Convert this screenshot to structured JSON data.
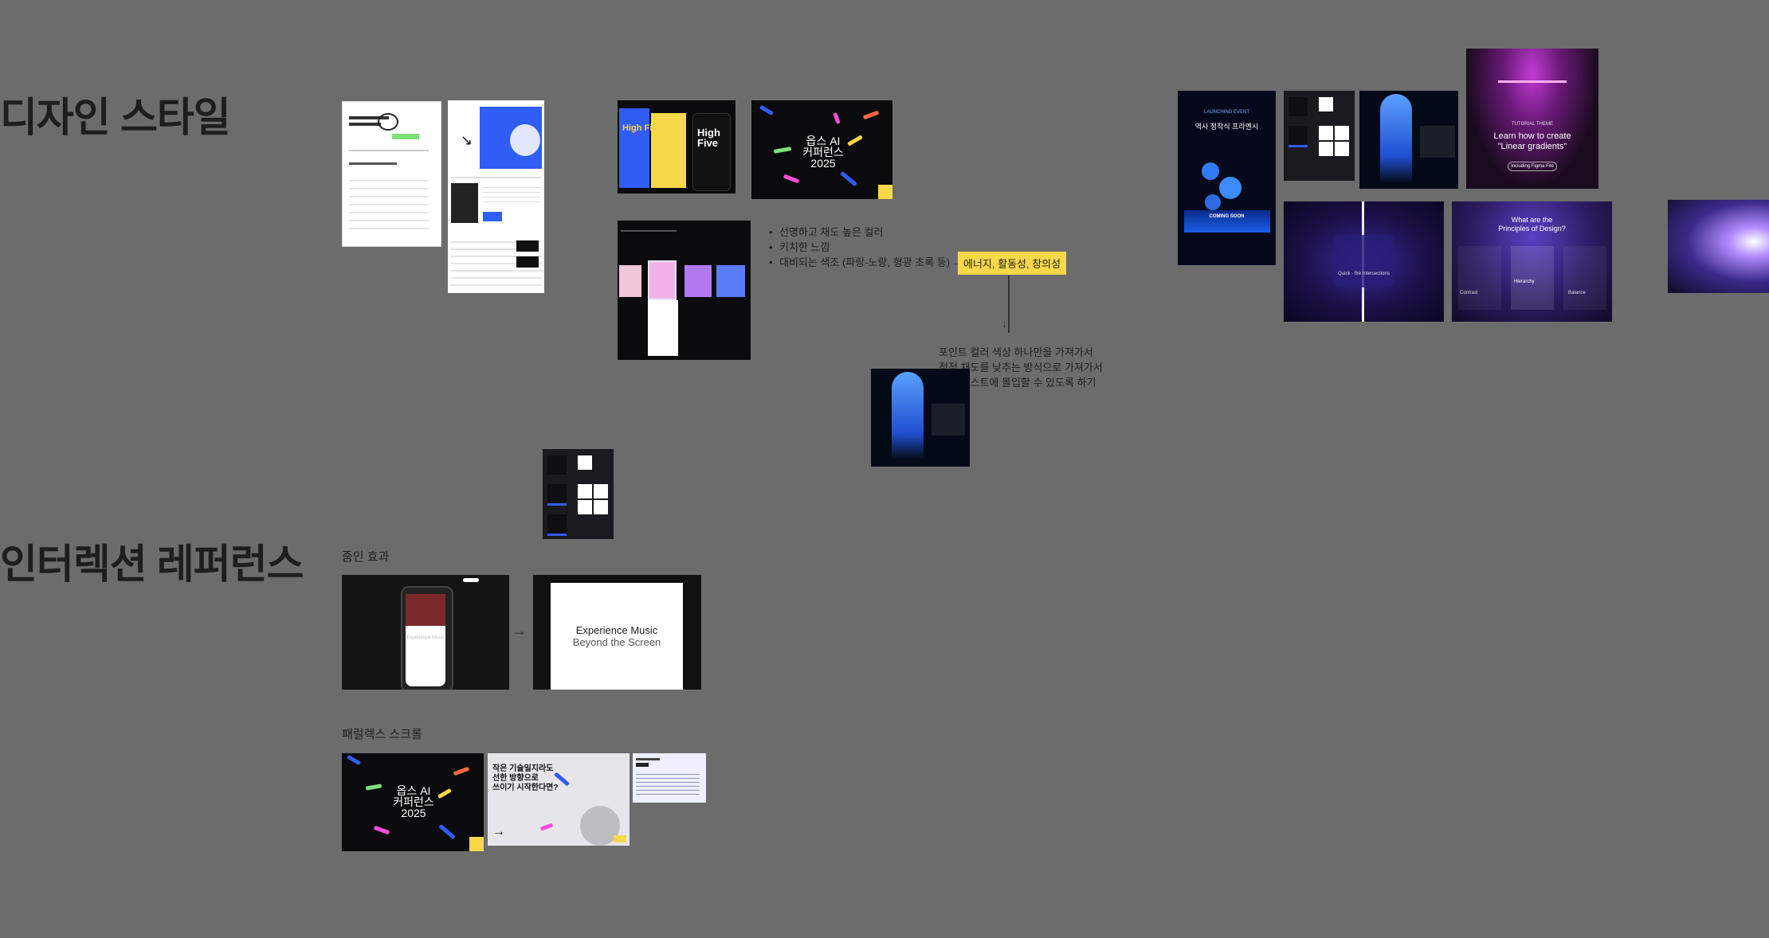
{
  "sections": {
    "design_style": {
      "title": "디자인 스타일"
    },
    "interaction_ref": {
      "title": "인터렉션 레퍼런스"
    }
  },
  "labels": {
    "zoom_in": "줌인 효과",
    "parallax": "패럴렉스 스크롤"
  },
  "notes": {
    "bullets": [
      "선명하고 채도 높은 컬러",
      "키치한 느낌",
      "대비되는 색조 (파랑-노랑, 형광 초록 등) →"
    ],
    "chip": "에너지, 활동성, 창의성",
    "arrow": "↓",
    "paragraph": [
      "포인트 컬러 색상 하나만을 가져가서",
      "점점 채도를 낮추는 방식으로 가져가서",
      "진단 테스트에 몰입할 수 있도록 하기"
    ]
  },
  "thumbs": {
    "high_five": "High Five",
    "ai_conf_line1": "옵스 AI",
    "ai_conf_line2": "커퍼런스",
    "ai_conf_year": "2025",
    "launching": "LAUNCHING EVENT",
    "korean_promo": "역사 정착식 프라멘시",
    "coming_soon": "COMING SOON",
    "tutorial": "TUTORIAL THEME",
    "linear_title1": "Learn how to create",
    "linear_title2": "\"Linear gradients\"",
    "linear_button": "Including Figma File",
    "quick_intersections": "Quick - fire Intersections",
    "principles1": "What are the",
    "principles2": "Principles of Design?",
    "hierarchy": "Hierarchy",
    "contrast": "Contrast",
    "balance": "Balance",
    "experience1": "Experience Music",
    "experience2": "Beyond the Screen",
    "experience_faint": "Experience Music",
    "small_tech1": "작은 기술일지라도",
    "small_tech2": "선한 방향으로",
    "small_tech3": "쓰이기 시작한다면?",
    "arrow_right": "→",
    "zoom_arrow": "→"
  },
  "colors": {
    "canvas": "#6c6c6c",
    "chip": "#f6d84a",
    "accent_blue": "#2f5df5",
    "accent_yellow": "#f6d84a",
    "purple": "#6a3fd1"
  }
}
